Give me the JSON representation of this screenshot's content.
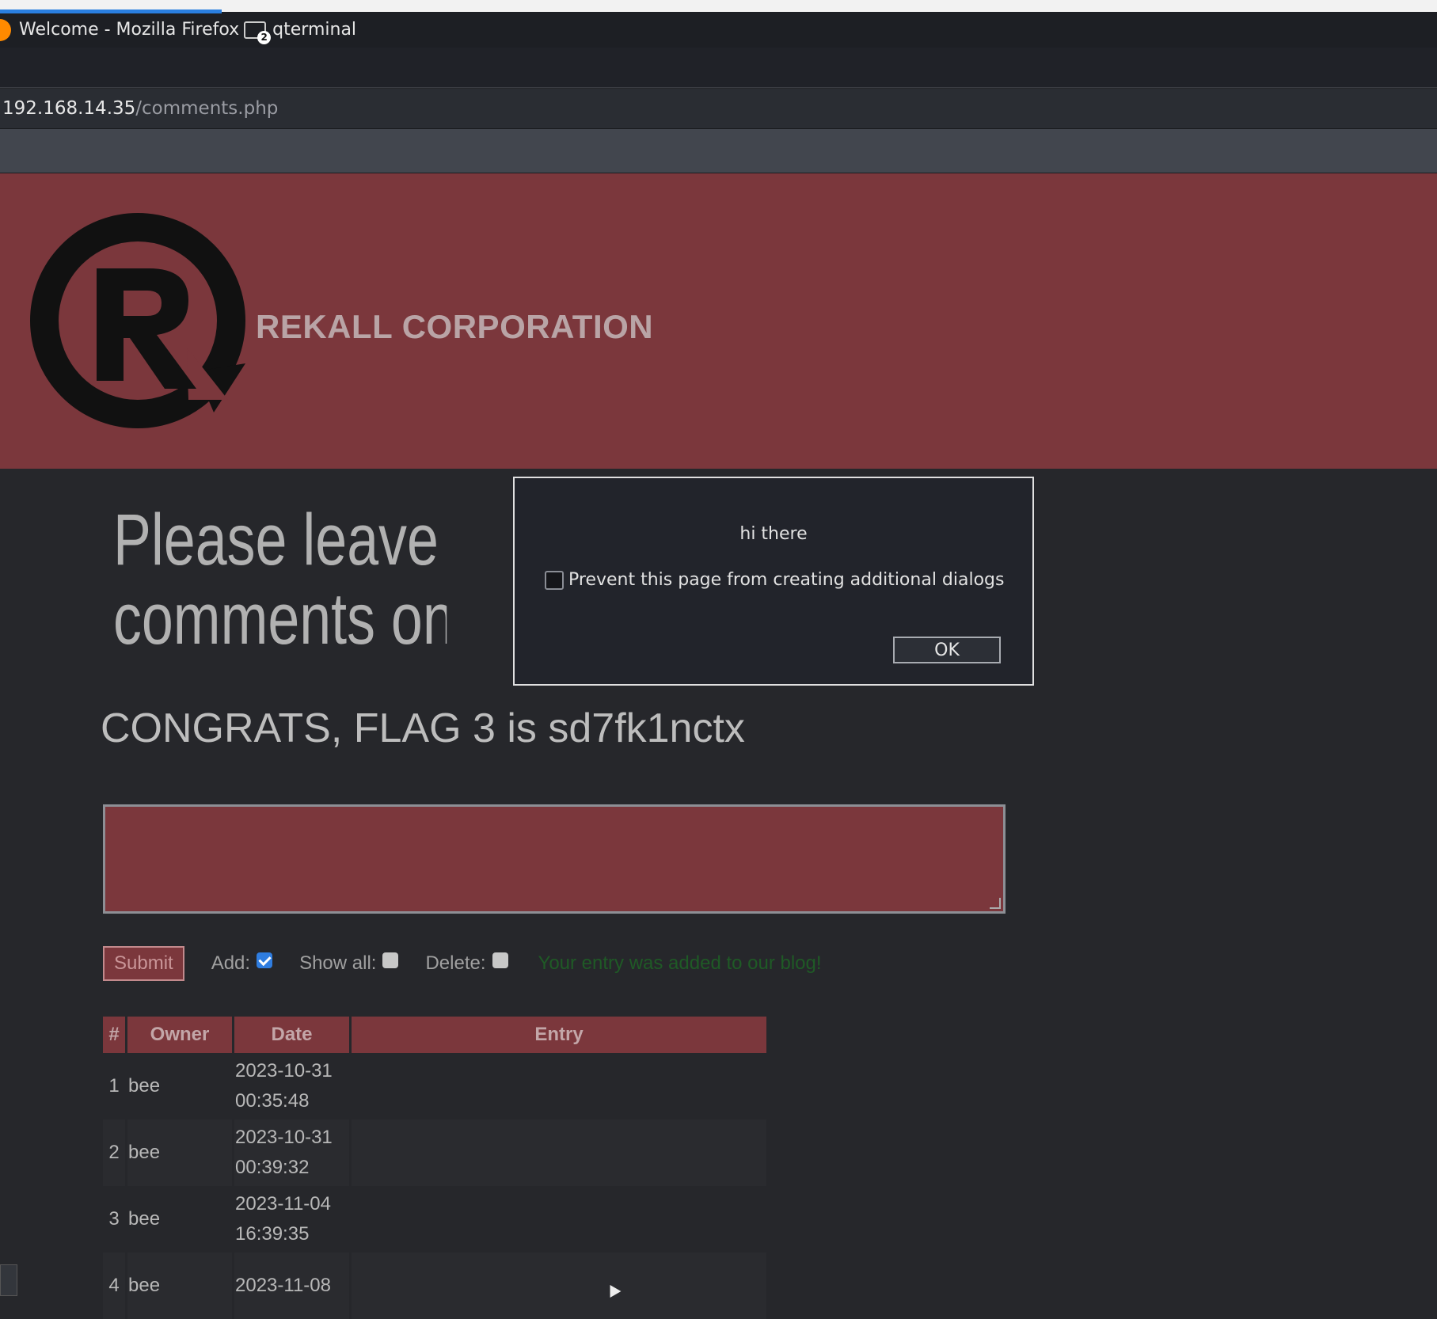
{
  "taskbar": {
    "window1": "Welcome - Mozilla Firefox",
    "window2": "qterminal",
    "terminal_badge": "2"
  },
  "address": {
    "host": "192.168.14.35",
    "path": "/comments.php"
  },
  "header": {
    "company": "REKALL CORPORATION",
    "brand_color": "#7b373c"
  },
  "content": {
    "heading_line1": "Please leave your",
    "heading_line2": "comments on our",
    "congrats": "CONGRATS, FLAG 3 is sd7fk1nctx"
  },
  "form": {
    "submit_label": "Submit",
    "add_label": "Add:",
    "add_checked": true,
    "show_all_label": "Show all:",
    "delete_label": "Delete:",
    "status": "Your entry was added to our blog!"
  },
  "table": {
    "headers": [
      "#",
      "Owner",
      "Date",
      "Entry"
    ],
    "rows": [
      {
        "num": "1",
        "owner": "bee",
        "date": "2023-10-31",
        "time": "00:35:48",
        "entry": ""
      },
      {
        "num": "2",
        "owner": "bee",
        "date": "2023-10-31",
        "time": "00:39:32",
        "entry": ""
      },
      {
        "num": "3",
        "owner": "bee",
        "date": "2023-11-04",
        "time": "16:39:35",
        "entry": ""
      },
      {
        "num": "4",
        "owner": "bee",
        "date": "2023-11-08",
        "time": "",
        "entry": ""
      }
    ]
  },
  "dialog": {
    "message": "hi there",
    "prevent_label": "Prevent this page from creating additional dialogs",
    "ok_label": "OK"
  }
}
